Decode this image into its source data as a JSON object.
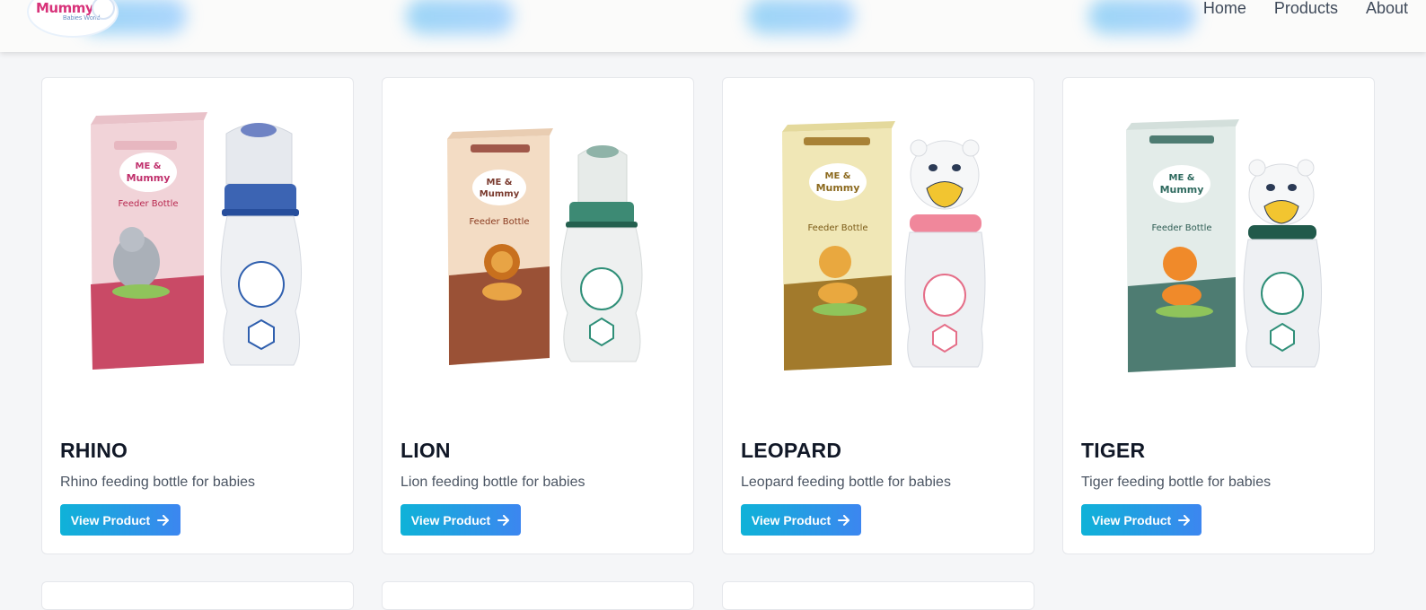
{
  "header": {
    "logo": {
      "name": "Mummy",
      "subtitle": "Babies World"
    },
    "nav": [
      {
        "label": "Home"
      },
      {
        "label": "Products"
      },
      {
        "label": "About"
      }
    ]
  },
  "products": [
    {
      "title": "RHINO",
      "description": "Rhino feeding bottle for babies",
      "button_label": "View Product",
      "animal": "rhino"
    },
    {
      "title": "LION",
      "description": "Lion feeding bottle for babies",
      "button_label": "View Product",
      "animal": "lion"
    },
    {
      "title": "LEOPARD",
      "description": "Leopard feeding bottle for babies",
      "button_label": "View Product",
      "animal": "leopard"
    },
    {
      "title": "TIGER",
      "description": "Tiger feeding bottle for babies",
      "button_label": "View Product",
      "animal": "tiger"
    }
  ],
  "colors": {
    "button_gradient_start": "#0fb2d8",
    "button_gradient_end": "#3c86f0",
    "logo_pink": "#d8337a"
  }
}
